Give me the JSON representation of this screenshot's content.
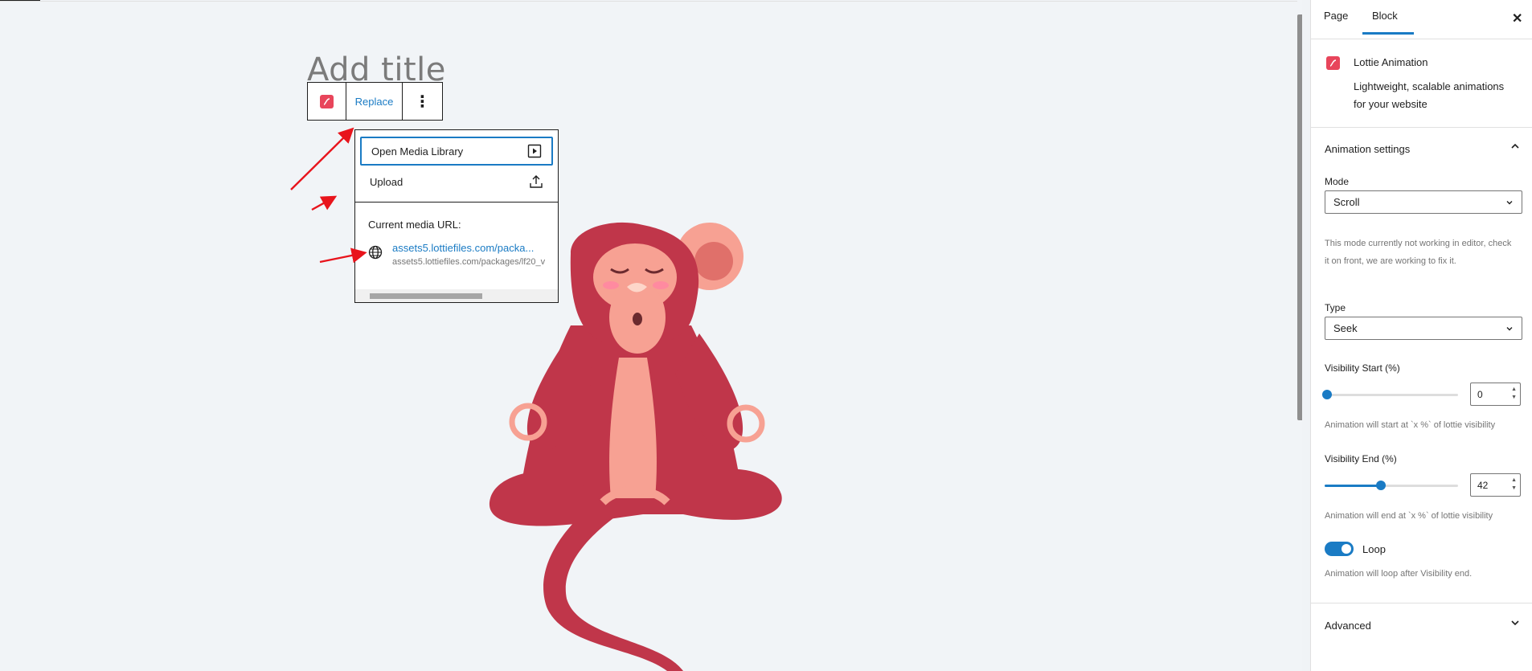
{
  "editor": {
    "title_placeholder": "Add title"
  },
  "block_toolbar": {
    "block_icon": "lottie-icon",
    "replace_label": "Replace",
    "more_label": "⋮"
  },
  "replace_dropdown": {
    "open_media_label": "Open Media Library",
    "upload_label": "Upload",
    "current_url_label": "Current media URL:",
    "current_url_link": "assets5.lottiefiles.com/packa...",
    "current_url_full": "assets5.lottiefiles.com/packages/lf20_v"
  },
  "sidebar": {
    "tabs": [
      {
        "label": "Page",
        "active": false
      },
      {
        "label": "Block",
        "active": true
      }
    ],
    "close_icon": "close-icon",
    "block_card": {
      "name": "Lottie Animation",
      "description": "Lightweight, scalable animations for your website"
    },
    "animation_settings": {
      "title": "Animation settings",
      "mode_label": "Mode",
      "mode_value": "Scroll",
      "mode_help": "This mode currently not working in editor, check it on front, we are working to fix it.",
      "type_label": "Type",
      "type_value": "Seek",
      "visibility_start_label": "Visibility Start (%)",
      "visibility_start_value": "0",
      "visibility_start_help": "Animation will start at `x %` of lottie visibility",
      "visibility_end_label": "Visibility End (%)",
      "visibility_end_value": "42",
      "visibility_end_help": "Animation will end at `x %` of lottie visibility",
      "loop_label": "Loop",
      "loop_on": true,
      "loop_help": "Animation will loop after Visibility end."
    },
    "advanced_title": "Advanced"
  },
  "colors": {
    "accent": "#1a7bc4",
    "lottie_brand": "#e8455b",
    "monkey_body": "#c0364a",
    "monkey_skin": "#f7a193",
    "annotation_arrow": "#e8141c"
  }
}
